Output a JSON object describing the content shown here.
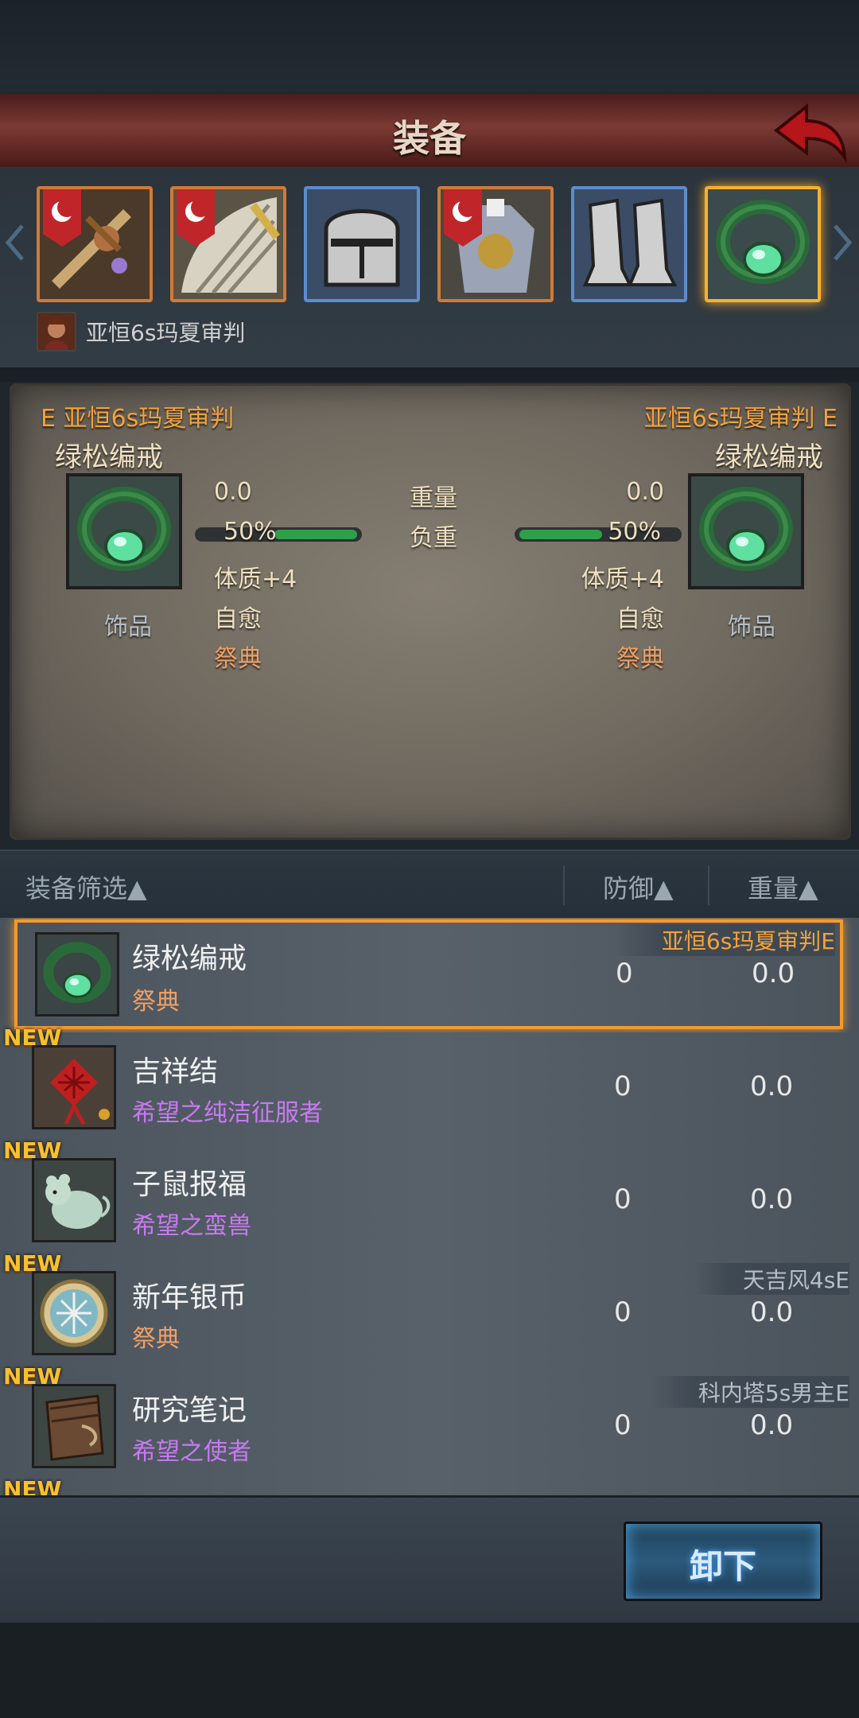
{
  "header": {
    "title": "装备"
  },
  "owner": {
    "name": "亚恒6s玛夏审判"
  },
  "compare": {
    "left": {
      "owner_tag": "E 亚恒6s玛夏审判",
      "item_name": "绿松编戒",
      "category": "饰品",
      "weight": "0.0",
      "load": "50%",
      "stat": "体质+4",
      "trait1": "自愈",
      "trait2": "祭典"
    },
    "right": {
      "owner_tag": "亚恒6s玛夏审判 E",
      "item_name": "绿松编戒",
      "category": "饰品",
      "weight": "0.0",
      "load": "50%",
      "stat": "体质+4",
      "trait1": "自愈",
      "trait2": "祭典"
    },
    "labels": {
      "weight": "重量",
      "load": "负重"
    },
    "load_fraction": 0.5
  },
  "filter": {
    "label": "装备筛选▲",
    "defense": "防御▲",
    "weight": "重量▲"
  },
  "items": [
    {
      "name": "绿松编戒",
      "sub": "祭典",
      "defense": "0",
      "weight": "0.0",
      "owner": "亚恒6s玛夏审判E",
      "new": ""
    },
    {
      "name": "吉祥结",
      "sub": "希望之纯洁征服者",
      "defense": "0",
      "weight": "0.0",
      "owner": "",
      "new": "NEW"
    },
    {
      "name": "子鼠报福",
      "sub": "希望之蛮兽",
      "defense": "0",
      "weight": "0.0",
      "owner": "",
      "new": "NEW"
    },
    {
      "name": "新年银币",
      "sub": "祭典",
      "defense": "0",
      "weight": "0.0",
      "owner": "天吉风4sE",
      "new": "NEW"
    },
    {
      "name": "研究笔记",
      "sub": "希望之使者",
      "defense": "0",
      "weight": "0.0",
      "owner": "科内塔5s男主E",
      "new": "NEW"
    },
    {
      "name": "",
      "sub": "",
      "defense": "",
      "weight": "",
      "owner": "",
      "new": "NEW"
    }
  ],
  "actions": {
    "unequip": "卸下"
  },
  "colors": {
    "accent_orange": "#f29a2f",
    "title_red": "#7a3a34",
    "button_blue": "#2b5a7c",
    "purple_text": "#c77af0"
  }
}
